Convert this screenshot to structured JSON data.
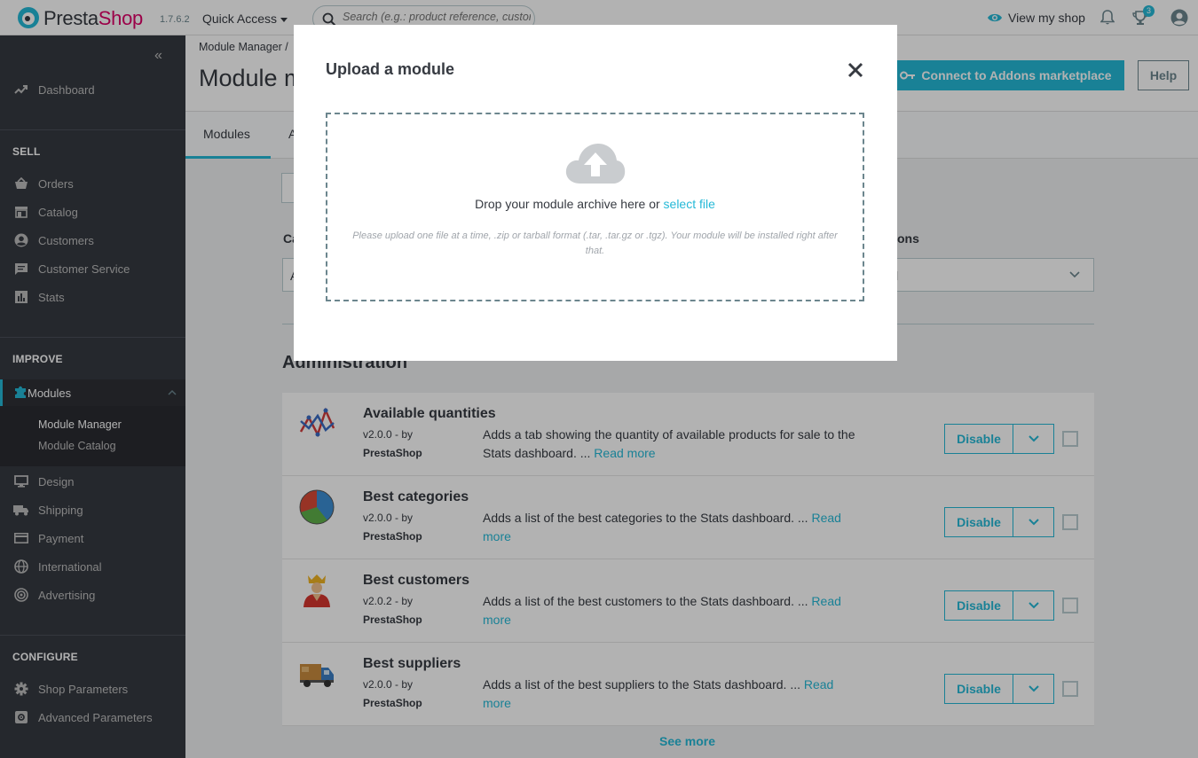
{
  "topbar": {
    "logo_text_presta": "Presta",
    "logo_text_shop": "Shop",
    "version": "1.7.6.2",
    "quick_access": "Quick Access",
    "search_placeholder": "Search (e.g.: product reference, custome",
    "view_shop": "View my shop",
    "notifications_count": "3"
  },
  "sidebar": {
    "dashboard": "Dashboard",
    "sell_title": "SELL",
    "sell_items": [
      "Orders",
      "Catalog",
      "Customers",
      "Customer Service",
      "Stats"
    ],
    "improve_title": "IMPROVE",
    "modules": "Modules",
    "module_sub": [
      "Module Manager",
      "Module Catalog"
    ],
    "improve_items": [
      "Design",
      "Shipping",
      "Payment",
      "International",
      "Advertising"
    ],
    "configure_title": "CONFIGURE",
    "configure_items": [
      "Shop Parameters",
      "Advanced Parameters"
    ]
  },
  "header": {
    "breadcrumb": "Module Manager  /",
    "title": "Module m",
    "connect_button": "Connect to Addons marketplace",
    "help_button": "Help",
    "tabs": [
      "Modules",
      "A"
    ]
  },
  "filters": {
    "category_label_partial": "Ca",
    "category_value_partial": "A",
    "status_label_partial": "ons",
    "status_value_partial": "l"
  },
  "section": {
    "title": "Administration"
  },
  "modules": [
    {
      "name": "Available quantities",
      "version": "v2.0.0 - by",
      "author": "PrestaShop",
      "description": "Adds a tab showing the quantity of available products for sale to the Stats dashboard. ...",
      "read_more": "Read more",
      "action": "Disable",
      "icon": "line-chart-icon"
    },
    {
      "name": "Best categories",
      "version": "v2.0.0 - by",
      "author": "PrestaShop",
      "description": "Adds a list of the best categories to the Stats dashboard. ...",
      "read_more": "Read more",
      "action": "Disable",
      "icon": "pie-chart-icon"
    },
    {
      "name": "Best customers",
      "version": "v2.0.2 - by",
      "author": "PrestaShop",
      "description": "Adds a list of the best customers to the Stats dashboard. ...",
      "read_more": "Read more",
      "action": "Disable",
      "icon": "king-icon"
    },
    {
      "name": "Best suppliers",
      "version": "v2.0.0 - by",
      "author": "PrestaShop",
      "description": "Adds a list of the best suppliers to the Stats dashboard. ...",
      "read_more": "Read more",
      "action": "Disable",
      "icon": "truck-icon"
    }
  ],
  "see_more": "See more",
  "modal": {
    "title": "Upload a module",
    "drop_text": "Drop your module archive here or",
    "select_file": "select file",
    "hint": "Please upload one file at a time, .zip or tarball format (.tar, .tar.gz or .tgz). Your module will be installed right after that."
  },
  "colors": {
    "accent": "#25b9d7",
    "sidebar_bg": "#363a41",
    "brand_pink": "#df0067"
  }
}
